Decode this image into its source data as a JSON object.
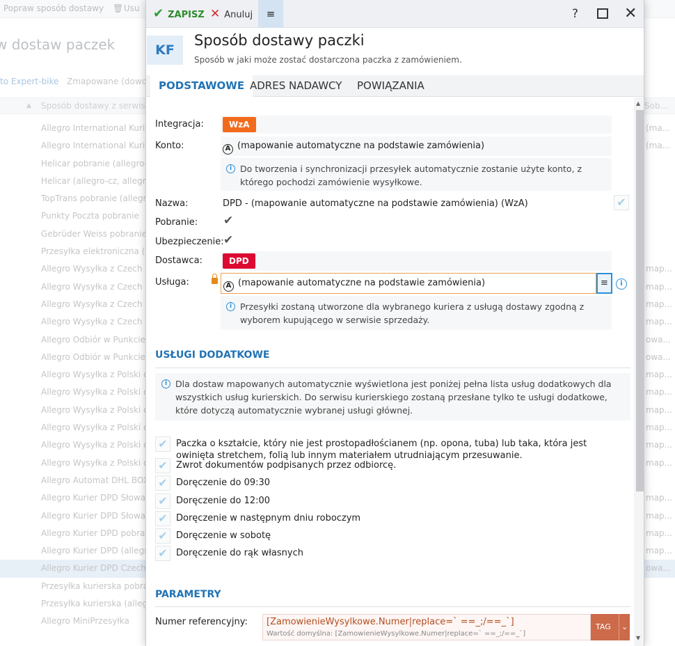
{
  "background": {
    "toolbar": {
      "improve": "Popraw sposób dostawy",
      "delete": "Usu"
    },
    "title": "w dostaw paczek",
    "filters": {
      "link": "to Expert-bike",
      "mapped": "Zmapowane (dowo"
    },
    "header": {
      "col1": "Sposób dostawy z serwis",
      "col2": "Sob..."
    },
    "rows": [
      {
        "name": "Allegro International Kuri",
        "map": "(ma..."
      },
      {
        "name": "Allegro International Kuri",
        "map": "(ma..."
      },
      {
        "name": "Helicar pobranie (allegro-",
        "map": ""
      },
      {
        "name": "Helicar (allegro-cz, allegr",
        "map": ""
      },
      {
        "name": "TopTrans pobranie (allegr",
        "map": ""
      },
      {
        "name": "Punkty Poczta pobranie",
        "map": ""
      },
      {
        "name": "Gebrüder Weiss pobranie",
        "map": ""
      },
      {
        "name": "Przesyłka elektroniczna (e",
        "map": ""
      },
      {
        "name": "Allegro Wysyłka z Czech d",
        "map": "map..."
      },
      {
        "name": "Allegro Wysyłka z Czech d",
        "map": "map..."
      },
      {
        "name": "Allegro Wysyłka z Czech d",
        "map": "map..."
      },
      {
        "name": "Allegro Wysyłka z Czech d",
        "map": "map..."
      },
      {
        "name": "Allegro Odbiór w Punkcie",
        "map": "owa..."
      },
      {
        "name": "Allegro Odbiór w Punkcie",
        "map": "owa..."
      },
      {
        "name": "Allegro Wysyłka z Polski d",
        "map": "map..."
      },
      {
        "name": "Allegro Wysyłka z Polski d",
        "map": "map..."
      },
      {
        "name": "Allegro Wysyłka z Polski d",
        "map": "map..."
      },
      {
        "name": "Allegro Wysyłka z Polski d",
        "map": "map..."
      },
      {
        "name": "Allegro Wysyłka z Polski d",
        "map": "map..."
      },
      {
        "name": "Allegro Wysyłka z Polski d",
        "map": "map..."
      },
      {
        "name": "Allegro Automat DHL BOX",
        "map": ""
      },
      {
        "name": "Allegro Kurier DPD Słowa",
        "map": "map..."
      },
      {
        "name": "Allegro Kurier DPD Słowa",
        "map": "map..."
      },
      {
        "name": "Allegro Kurier DPD pobran",
        "map": "map..."
      },
      {
        "name": "Allegro Kurier DPD (allegr",
        "map": "map..."
      },
      {
        "name": "Allegro Kurier DPD Czechy",
        "map": "owa..."
      },
      {
        "name": "Przesyłka kurierska pobra",
        "map": ""
      },
      {
        "name": "Przesyłka kurierska (allegr",
        "map": ""
      },
      {
        "name": "Allegro MiniPrzesyłka",
        "map": ""
      }
    ]
  },
  "modal": {
    "toolbar": {
      "save": "ZAPISZ",
      "cancel": "Anuluj",
      "menu": "≡",
      "help": "?",
      "close": "✕"
    },
    "badge": "KF",
    "title": "Sposób dostawy paczki",
    "subtitle": "Sposób w jaki może zostać dostarczona paczka z zamówieniem.",
    "tabs": [
      "PODSTAWOWE",
      "ADRES NADAWCY",
      "POWIĄZANIA"
    ],
    "fields": {
      "integration_label": "Integracja:",
      "integration_value": "WzA",
      "account_label": "Konto:",
      "account_value": "(mapowanie automatyczne na podstawie zamówienia)",
      "account_info": "Do tworzenia i synchronizacji przesyłek automatycznie zostanie użyte konto, z którego pochodzi zamówienie wysyłkowe.",
      "name_label": "Nazwa:",
      "name_value": "DPD - (mapowanie automatyczne na podstawie zamówienia) (WzA)",
      "cod_label": "Pobranie:",
      "insurance_label": "Ubezpieczenie:",
      "carrier_label": "Dostawca:",
      "carrier_value": "DPD",
      "service_label": "Usługa:",
      "service_value": "(mapowanie automatyczne na podstawie zamówienia)",
      "service_info": "Przesyłki zostaną utworzone dla wybranego kuriera z usługą dostawy zgodną z wyborem kupującego w serwisie sprzedaży."
    },
    "extra_services": {
      "title": "USŁUGI DODATKOWE",
      "info": "Dla dostaw mapowanych automatycznie wyświetlona jest poniżej pełna lista usług dodatkowych dla wszystkich usług kurierskich. Do serwisu kurierskiego zostaną przesłane tylko te usługi dodatkowe, które dotyczą automatycznie wybranej usługi głównej.",
      "options": [
        "Paczka o kształcie, który nie jest prostopadłościanem (np. opona, tuba) lub taka, która jest owinięta stretchem, folią lub innym materiałem utrudniającym przesuwanie.",
        "Zwrot dokumentów podpisanych przez odbiorcę.",
        "Doręczenie do 09:30",
        "Doręczenie do 12:00",
        "Doręczenie w następnym dniu roboczym",
        "Doręczenie w sobotę",
        "Doręczenie do rąk własnych"
      ]
    },
    "parameters": {
      "title": "PARAMETRY",
      "ref_label": "Numer referencyjny:",
      "ref_value": "[ZamowienieWysylkowe.Numer|replace=` ==_;/==_`]",
      "ref_default": "Wartość domyślna: [ZamowienieWysylkowe.Numer|replace=` ==_;/==_`]",
      "tag_label": "TAG"
    }
  }
}
